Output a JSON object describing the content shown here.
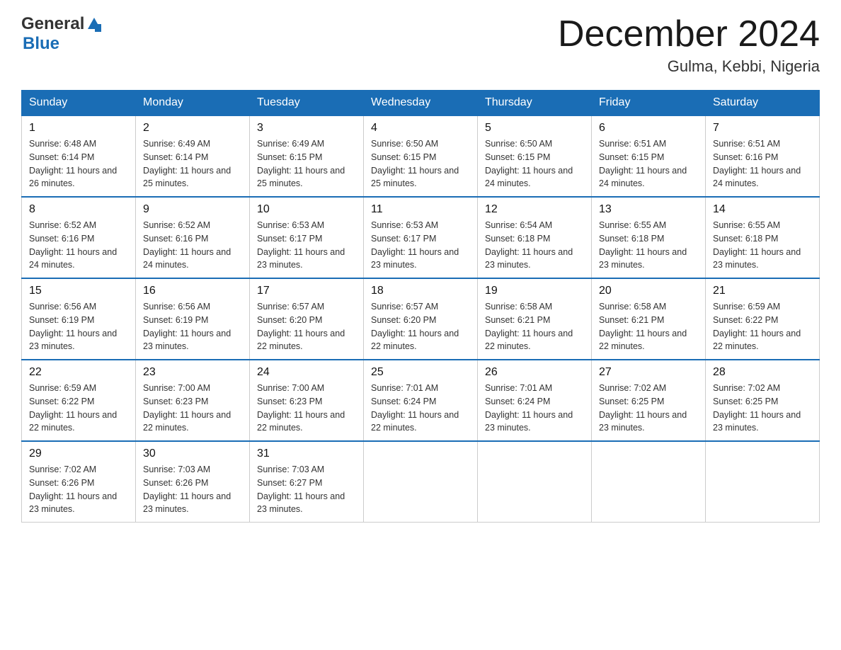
{
  "header": {
    "logo_general": "General",
    "logo_blue": "Blue",
    "month_title": "December 2024",
    "location": "Gulma, Kebbi, Nigeria"
  },
  "days_of_week": [
    "Sunday",
    "Monday",
    "Tuesday",
    "Wednesday",
    "Thursday",
    "Friday",
    "Saturday"
  ],
  "weeks": [
    [
      {
        "day": "1",
        "sunrise": "6:48 AM",
        "sunset": "6:14 PM",
        "daylight": "11 hours and 26 minutes."
      },
      {
        "day": "2",
        "sunrise": "6:49 AM",
        "sunset": "6:14 PM",
        "daylight": "11 hours and 25 minutes."
      },
      {
        "day": "3",
        "sunrise": "6:49 AM",
        "sunset": "6:15 PM",
        "daylight": "11 hours and 25 minutes."
      },
      {
        "day": "4",
        "sunrise": "6:50 AM",
        "sunset": "6:15 PM",
        "daylight": "11 hours and 25 minutes."
      },
      {
        "day": "5",
        "sunrise": "6:50 AM",
        "sunset": "6:15 PM",
        "daylight": "11 hours and 24 minutes."
      },
      {
        "day": "6",
        "sunrise": "6:51 AM",
        "sunset": "6:15 PM",
        "daylight": "11 hours and 24 minutes."
      },
      {
        "day": "7",
        "sunrise": "6:51 AM",
        "sunset": "6:16 PM",
        "daylight": "11 hours and 24 minutes."
      }
    ],
    [
      {
        "day": "8",
        "sunrise": "6:52 AM",
        "sunset": "6:16 PM",
        "daylight": "11 hours and 24 minutes."
      },
      {
        "day": "9",
        "sunrise": "6:52 AM",
        "sunset": "6:16 PM",
        "daylight": "11 hours and 24 minutes."
      },
      {
        "day": "10",
        "sunrise": "6:53 AM",
        "sunset": "6:17 PM",
        "daylight": "11 hours and 23 minutes."
      },
      {
        "day": "11",
        "sunrise": "6:53 AM",
        "sunset": "6:17 PM",
        "daylight": "11 hours and 23 minutes."
      },
      {
        "day": "12",
        "sunrise": "6:54 AM",
        "sunset": "6:18 PM",
        "daylight": "11 hours and 23 minutes."
      },
      {
        "day": "13",
        "sunrise": "6:55 AM",
        "sunset": "6:18 PM",
        "daylight": "11 hours and 23 minutes."
      },
      {
        "day": "14",
        "sunrise": "6:55 AM",
        "sunset": "6:18 PM",
        "daylight": "11 hours and 23 minutes."
      }
    ],
    [
      {
        "day": "15",
        "sunrise": "6:56 AM",
        "sunset": "6:19 PM",
        "daylight": "11 hours and 23 minutes."
      },
      {
        "day": "16",
        "sunrise": "6:56 AM",
        "sunset": "6:19 PM",
        "daylight": "11 hours and 23 minutes."
      },
      {
        "day": "17",
        "sunrise": "6:57 AM",
        "sunset": "6:20 PM",
        "daylight": "11 hours and 22 minutes."
      },
      {
        "day": "18",
        "sunrise": "6:57 AM",
        "sunset": "6:20 PM",
        "daylight": "11 hours and 22 minutes."
      },
      {
        "day": "19",
        "sunrise": "6:58 AM",
        "sunset": "6:21 PM",
        "daylight": "11 hours and 22 minutes."
      },
      {
        "day": "20",
        "sunrise": "6:58 AM",
        "sunset": "6:21 PM",
        "daylight": "11 hours and 22 minutes."
      },
      {
        "day": "21",
        "sunrise": "6:59 AM",
        "sunset": "6:22 PM",
        "daylight": "11 hours and 22 minutes."
      }
    ],
    [
      {
        "day": "22",
        "sunrise": "6:59 AM",
        "sunset": "6:22 PM",
        "daylight": "11 hours and 22 minutes."
      },
      {
        "day": "23",
        "sunrise": "7:00 AM",
        "sunset": "6:23 PM",
        "daylight": "11 hours and 22 minutes."
      },
      {
        "day": "24",
        "sunrise": "7:00 AM",
        "sunset": "6:23 PM",
        "daylight": "11 hours and 22 minutes."
      },
      {
        "day": "25",
        "sunrise": "7:01 AM",
        "sunset": "6:24 PM",
        "daylight": "11 hours and 22 minutes."
      },
      {
        "day": "26",
        "sunrise": "7:01 AM",
        "sunset": "6:24 PM",
        "daylight": "11 hours and 23 minutes."
      },
      {
        "day": "27",
        "sunrise": "7:02 AM",
        "sunset": "6:25 PM",
        "daylight": "11 hours and 23 minutes."
      },
      {
        "day": "28",
        "sunrise": "7:02 AM",
        "sunset": "6:25 PM",
        "daylight": "11 hours and 23 minutes."
      }
    ],
    [
      {
        "day": "29",
        "sunrise": "7:02 AM",
        "sunset": "6:26 PM",
        "daylight": "11 hours and 23 minutes."
      },
      {
        "day": "30",
        "sunrise": "7:03 AM",
        "sunset": "6:26 PM",
        "daylight": "11 hours and 23 minutes."
      },
      {
        "day": "31",
        "sunrise": "7:03 AM",
        "sunset": "6:27 PM",
        "daylight": "11 hours and 23 minutes."
      },
      null,
      null,
      null,
      null
    ]
  ]
}
